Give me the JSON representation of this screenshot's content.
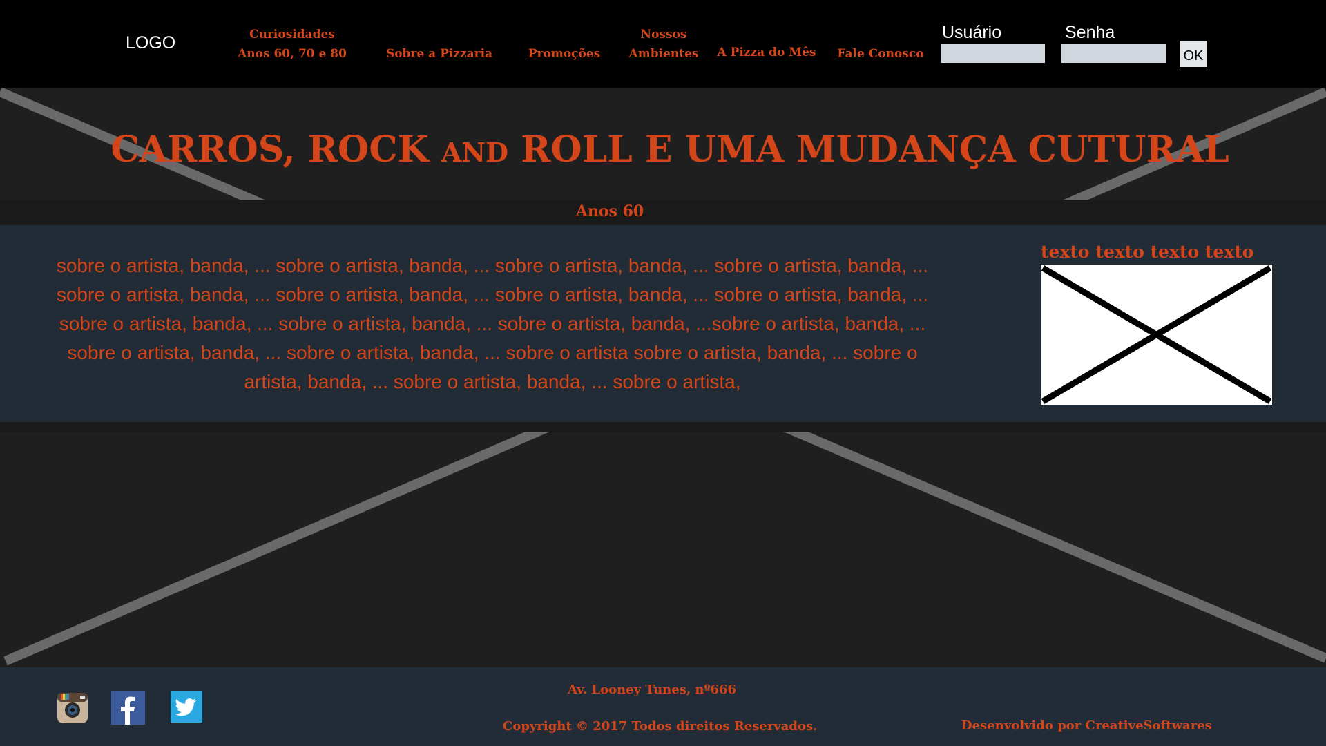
{
  "header": {
    "logo": "LOGO",
    "nav": [
      {
        "line1": "Curiosidades",
        "line2": "Anos 60, 70 e 80"
      },
      {
        "line1": "",
        "line2": "Sobre a Pizzaria"
      },
      {
        "line1": "",
        "line2": "Promoções"
      },
      {
        "line1": "Nossos",
        "line2": "Ambientes"
      },
      {
        "line1": "",
        "line2": "A Pizza do Mês"
      },
      {
        "line1": "",
        "line2": "Fale Conosco"
      }
    ],
    "login": {
      "user_label": "Usuário",
      "password_label": "Senha",
      "user_value": "",
      "password_value": "",
      "ok_label": "OK"
    }
  },
  "main": {
    "title_part1": "CARROS,  ROCK ",
    "title_part2": "AND",
    "title_part3": " ROLL E UMA MUDANÇA CUTURAL",
    "section_title": "Anos 60",
    "body_text": "sobre o artista, banda, ... sobre o artista, banda, ... sobre o artista, banda, ... sobre o artista, banda, ... sobre o artista, banda, ... sobre o artista, banda, ... sobre o artista, banda, ... sobre o artista, banda, ... sobre o artista, banda, ... sobre o artista, banda, ... sobre o artista, banda, ...sobre o artista, banda, ... sobre o artista, banda, ... sobre o artista, banda, ... sobre o artista sobre o artista, banda, ... sobre o artista, banda, ... sobre o artista, banda, ... sobre o artista,",
    "side_heading": "texto texto texto texto"
  },
  "footer": {
    "address": "Av. Looney Tunes, nº666",
    "copyright": "Copyright © 2017 Todos direitos Reservados.",
    "developer": "Desenvolvido  por  CreativeSoftwares",
    "social_icons": [
      "instagram-icon",
      "facebook-icon",
      "twitter-icon"
    ]
  },
  "colors": {
    "accent": "#d4451a",
    "header_bg": "#000000",
    "page_bg": "#1f1f1f",
    "panel_bg": "#222c36",
    "input_bg": "#cfd6dd"
  }
}
